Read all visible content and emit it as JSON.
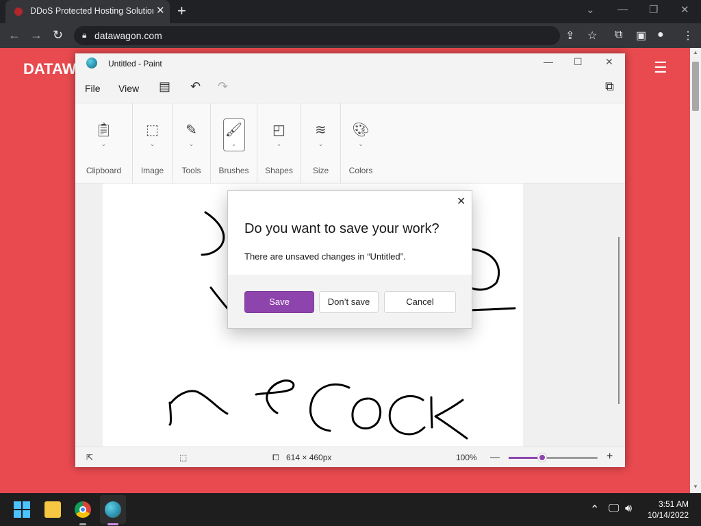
{
  "browser": {
    "tab_title": "DDoS Protected Hosting Solution",
    "url": "datawagon.com"
  },
  "page": {
    "brand": "DATAW"
  },
  "paint": {
    "window_title": "Untitled - Paint",
    "menu": {
      "file": "File",
      "view": "View"
    },
    "ribbon_groups": [
      "Clipboard",
      "Image",
      "Tools",
      "Brushes",
      "Shapes",
      "Size",
      "Colors"
    ],
    "status": {
      "dimensions": "614 × 460px",
      "zoom": "100%",
      "zoom_fraction": 0.38
    }
  },
  "dialog": {
    "title": "Do you want to save your work?",
    "message": "There are unsaved changes in “Untitled”.",
    "save_label": "Save",
    "dont_save_label": "Don’t save",
    "cancel_label": "Cancel"
  },
  "taskbar": {
    "time": "3:51 AM",
    "date": "10/14/2022"
  },
  "colors": {
    "accent": "#8e44ad",
    "page_bg": "#e84a4f"
  }
}
